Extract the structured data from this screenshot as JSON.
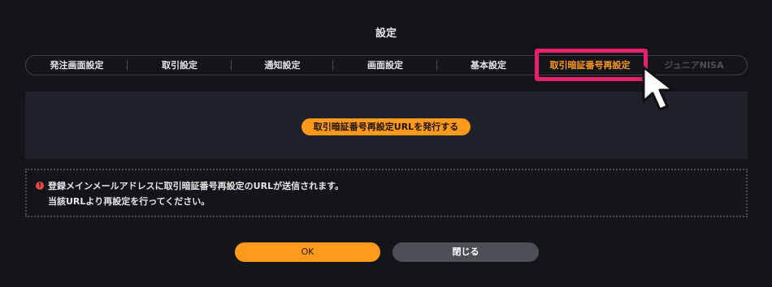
{
  "dialog": {
    "title": "設定"
  },
  "tabs": [
    {
      "label": "発注画面設定"
    },
    {
      "label": "取引設定"
    },
    {
      "label": "通知設定"
    },
    {
      "label": "画面設定"
    },
    {
      "label": "基本設定"
    },
    {
      "label": "取引暗証番号再設定",
      "state": "active"
    },
    {
      "label": "ジュニアNISA",
      "state": "disabled"
    }
  ],
  "panel": {
    "issue_button_label": "取引暗証番号再設定URLを発行する"
  },
  "notice": {
    "icon": "info-icon",
    "line1": "登録メインメールアドレスに取引暗証番号再設定のURLが送信されます。",
    "line2": "当該URLより再設定を行ってください。"
  },
  "footer": {
    "ok_label": "OK",
    "close_label": "閉じる"
  },
  "colors": {
    "background": "#141519",
    "accent": "#ff9a1a",
    "highlight": "#e6206c",
    "panel": "#202229"
  }
}
